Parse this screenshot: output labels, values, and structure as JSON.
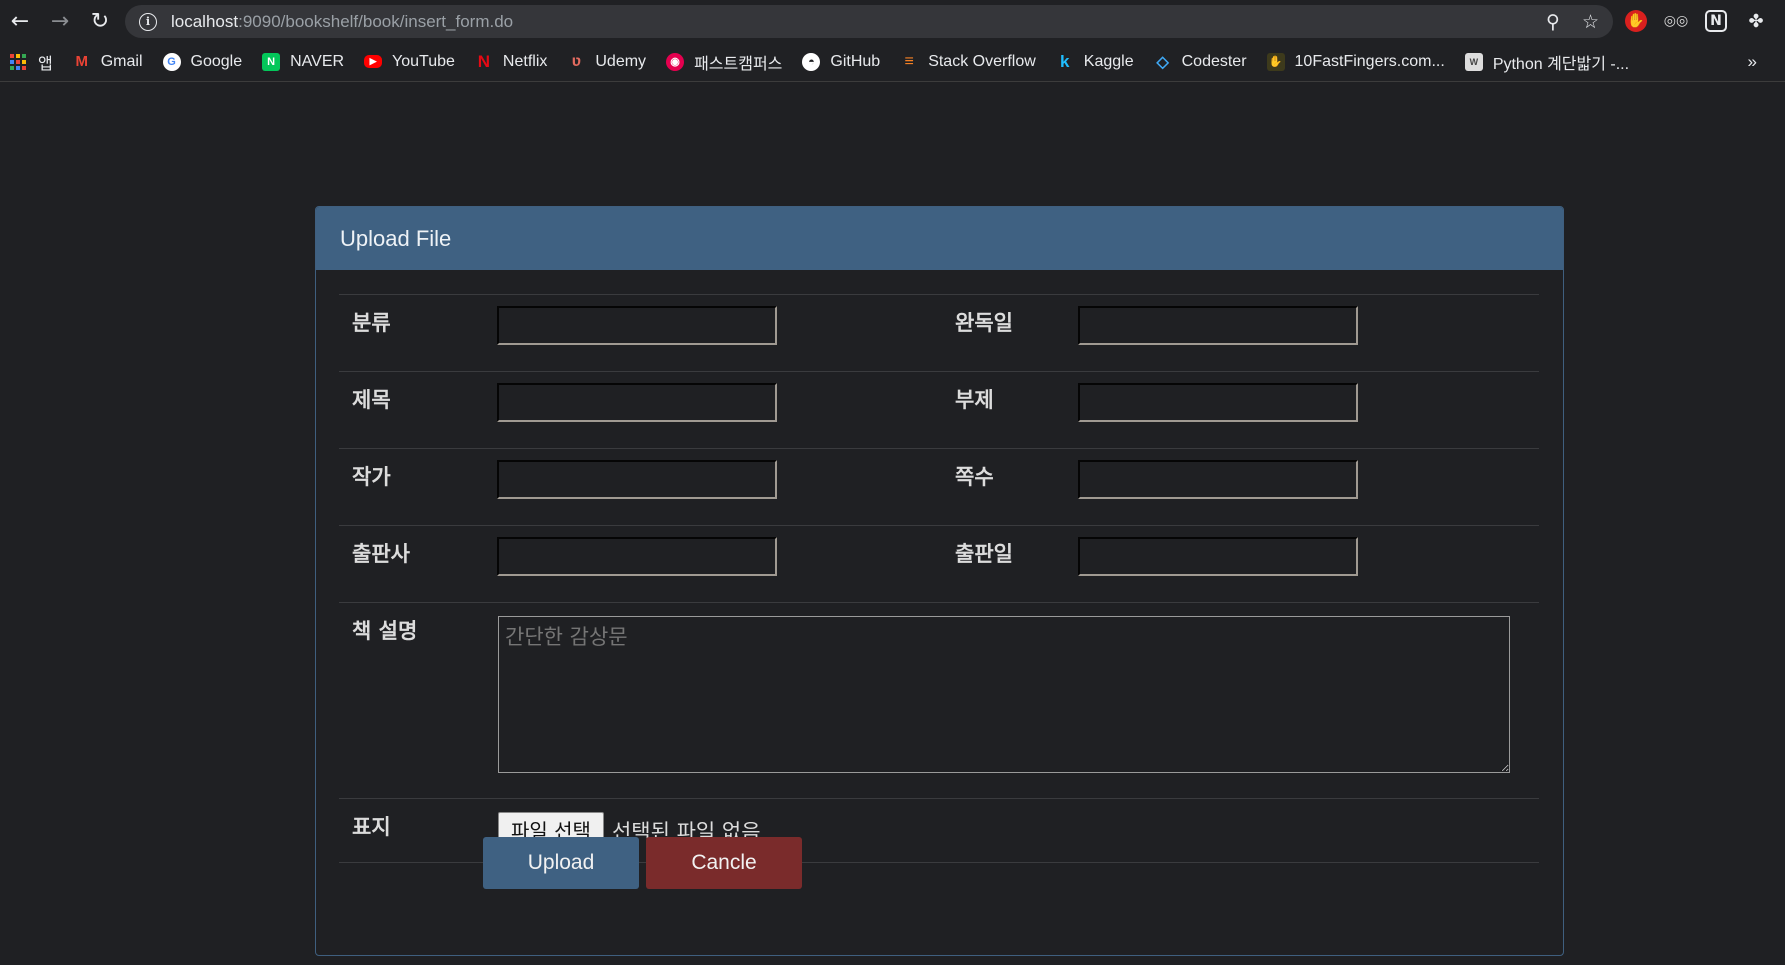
{
  "browser": {
    "url_host": "localhost",
    "url_path": ":9090/bookshelf/book/insert_form.do"
  },
  "bookmarks": {
    "apps_label": "앱",
    "items": [
      {
        "label": "Gmail",
        "icon": "gmail-icon",
        "color": "#ea4335",
        "glyph": "M"
      },
      {
        "label": "Google",
        "icon": "google-icon",
        "color": "#ffffff",
        "glyph": "G"
      },
      {
        "label": "NAVER",
        "icon": "naver-icon",
        "color": "#03c75a",
        "glyph": "N"
      },
      {
        "label": "YouTube",
        "icon": "youtube-icon",
        "color": "#ff0000",
        "glyph": "▶"
      },
      {
        "label": "Netflix",
        "icon": "netflix-icon",
        "color": "#e50914",
        "glyph": "N"
      },
      {
        "label": "Udemy",
        "icon": "udemy-icon",
        "color": "#a435f0",
        "glyph": "U"
      },
      {
        "label": "패스트캠퍼스",
        "icon": "fastcampus-icon",
        "color": "#e5004f",
        "glyph": "◉"
      },
      {
        "label": "GitHub",
        "icon": "github-icon",
        "color": "#ffffff",
        "glyph": "◓"
      },
      {
        "label": "Stack Overflow",
        "icon": "stackoverflow-icon",
        "color": "#f48024",
        "glyph": "≡"
      },
      {
        "label": "Kaggle",
        "icon": "kaggle-icon",
        "color": "#20beff",
        "glyph": "k"
      },
      {
        "label": "Codester",
        "icon": "codester-icon",
        "color": "#3fa9f5",
        "glyph": "◇"
      },
      {
        "label": "10FastFingers.com...",
        "icon": "10fastfingers-icon",
        "color": "#c9b037",
        "glyph": "✋"
      },
      {
        "label": "Python 계단밟기 -...",
        "icon": "wikidocs-icon",
        "color": "#cccccc",
        "glyph": "W"
      }
    ],
    "more": "»"
  },
  "panel": {
    "title": "Upload File"
  },
  "form": {
    "fields": [
      {
        "left_label": "분류",
        "right_label": "완독일"
      },
      {
        "left_label": "제목",
        "right_label": "부제"
      },
      {
        "left_label": "작가",
        "right_label": "쪽수"
      },
      {
        "left_label": "출판사",
        "right_label": "출판일"
      }
    ],
    "description_label": "책 설명",
    "description_placeholder": "간단한 감상문",
    "cover_label": "표지",
    "file_button": "파일 선택",
    "file_status": "선택된 파일 없음",
    "upload_button": "Upload",
    "cancel_button": "Cancle"
  },
  "colors": {
    "accent": "#3f6182",
    "cancel": "#7a2b2b",
    "background": "#1f2023"
  }
}
